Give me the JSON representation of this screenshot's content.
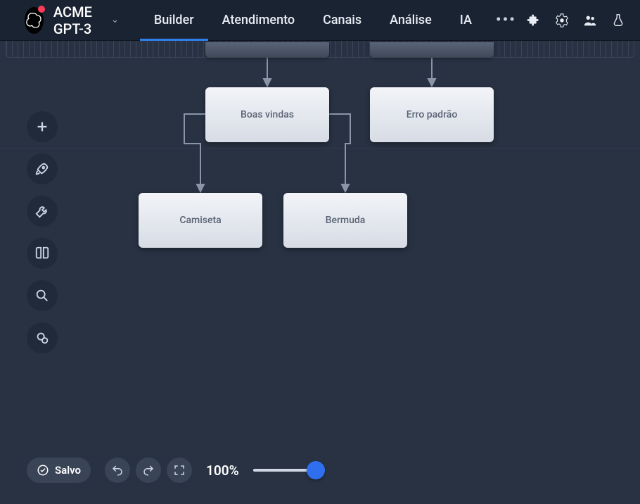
{
  "header": {
    "app_name": "ACME GPT-3",
    "tabs": [
      {
        "label": "Builder",
        "active": true
      },
      {
        "label": "Atendimento",
        "active": false
      },
      {
        "label": "Canais",
        "active": false
      },
      {
        "label": "Análise",
        "active": false
      },
      {
        "label": "IA",
        "active": false
      }
    ],
    "more": "•••"
  },
  "nodes": {
    "boas_vindas": "Boas vindas",
    "erro_padrao": "Erro padrão",
    "camiseta": "Camiseta",
    "bermuda": "Bermuda"
  },
  "footer": {
    "status": "Salvo",
    "zoom": "100%"
  }
}
